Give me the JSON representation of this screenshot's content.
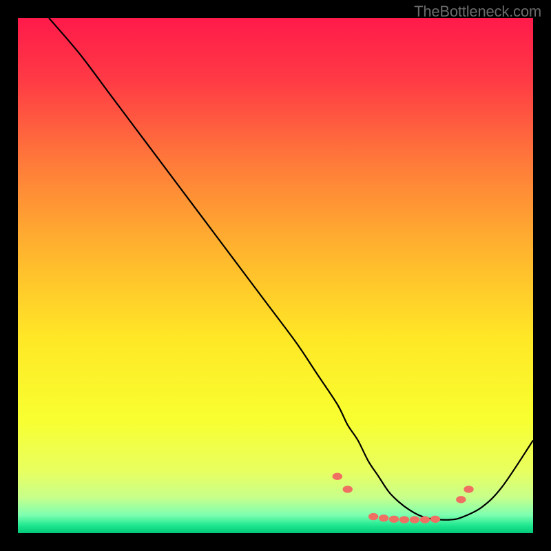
{
  "watermark": "TheBottleneck.com",
  "chart_data": {
    "type": "line",
    "title": "",
    "xlabel": "",
    "ylabel": "",
    "xlim": [
      0,
      100
    ],
    "ylim": [
      0,
      100
    ],
    "grid": false,
    "series": [
      {
        "name": "curve",
        "color": "#000000",
        "x": [
          6,
          12,
          18,
          24,
          30,
          36,
          42,
          48,
          54,
          58,
          62,
          64,
          66,
          68,
          70,
          72,
          74,
          76,
          78,
          80,
          82,
          84,
          86,
          90,
          94,
          100
        ],
        "y": [
          100,
          93,
          85,
          77,
          69,
          61,
          53,
          45,
          37,
          31,
          25,
          21,
          18,
          14,
          11,
          8,
          6,
          4.5,
          3.4,
          2.8,
          2.6,
          2.6,
          3.0,
          5.0,
          9.0,
          18
        ]
      }
    ],
    "markers": {
      "color": "#ef6f63",
      "rx": 5.5,
      "ry": 4.0,
      "points": [
        {
          "x": 62,
          "y": 11.0
        },
        {
          "x": 64,
          "y": 8.5
        },
        {
          "x": 69,
          "y": 3.2
        },
        {
          "x": 71,
          "y": 2.9
        },
        {
          "x": 73,
          "y": 2.7
        },
        {
          "x": 75,
          "y": 2.6
        },
        {
          "x": 77,
          "y": 2.6
        },
        {
          "x": 79,
          "y": 2.6
        },
        {
          "x": 81,
          "y": 2.7
        },
        {
          "x": 86,
          "y": 6.5
        },
        {
          "x": 87.5,
          "y": 8.5
        }
      ]
    },
    "background_gradient": [
      {
        "offset": 0.0,
        "color": "#ff1a4a"
      },
      {
        "offset": 0.12,
        "color": "#ff3a45"
      },
      {
        "offset": 0.28,
        "color": "#ff7a3a"
      },
      {
        "offset": 0.45,
        "color": "#ffb42e"
      },
      {
        "offset": 0.62,
        "color": "#ffe726"
      },
      {
        "offset": 0.78,
        "color": "#f8ff30"
      },
      {
        "offset": 0.88,
        "color": "#e8ff60"
      },
      {
        "offset": 0.93,
        "color": "#c8ff8a"
      },
      {
        "offset": 0.965,
        "color": "#7dffb0"
      },
      {
        "offset": 0.985,
        "color": "#20e890"
      },
      {
        "offset": 1.0,
        "color": "#00c878"
      }
    ]
  }
}
